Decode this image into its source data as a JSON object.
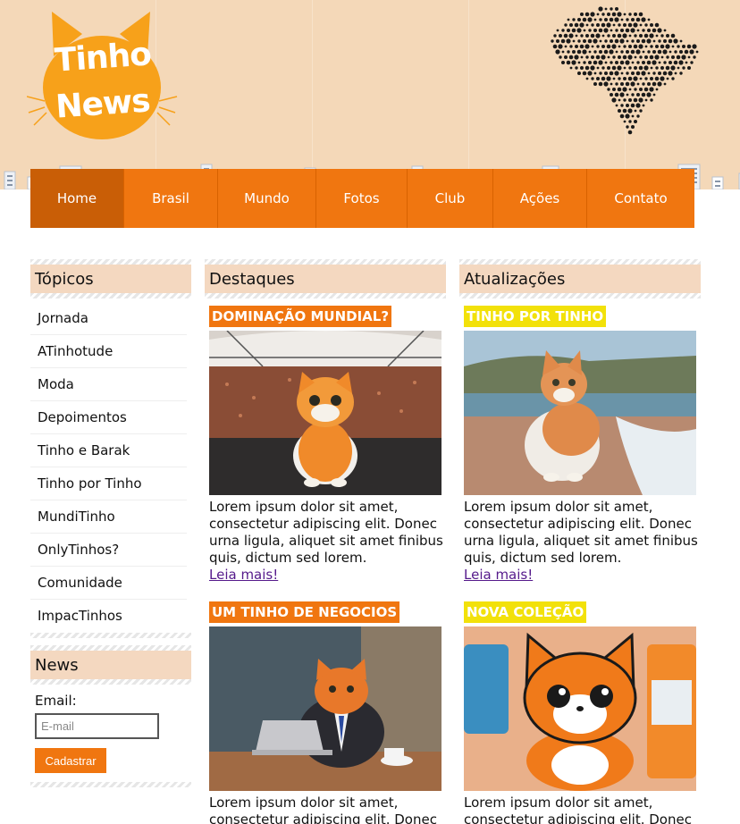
{
  "brand": {
    "line1": "Tinho",
    "line2": "News"
  },
  "nav": {
    "items": [
      {
        "label": "Home"
      },
      {
        "label": "Brasil"
      },
      {
        "label": "Mundo"
      },
      {
        "label": "Fotos"
      },
      {
        "label": "Club"
      },
      {
        "label": "Ações"
      },
      {
        "label": "Contato"
      }
    ],
    "active": "Home"
  },
  "sidebar": {
    "topics_title": "Tópicos",
    "topics": [
      "Jornada",
      "ATinhotude",
      "Moda",
      "Depoimentos",
      "Tinho e Barak",
      "Tinho por Tinho",
      "MundiTinho",
      "OnlyTinhos?",
      "Comunidade",
      "ImpacTinhos"
    ],
    "news_title": "News",
    "email_label": "Email:",
    "email_placeholder": "E-mail",
    "submit_label": "Cadastrar"
  },
  "columns": {
    "destaques": {
      "title": "Destaques",
      "articles": [
        {
          "tag": "DOMINAÇÃO MUNDIAL?",
          "text": "Lorem ipsum dolor sit amet, consectetur adipiscing elit. Donec urna ligula, aliquet sit amet finibus quis, dictum sed lorem.",
          "more": "Leia mais!"
        },
        {
          "tag": "UM TINHO DE NEGOCIOS",
          "text": "Lorem ipsum dolor sit amet, consectetur adipiscing elit. Donec urna ligula, aliquet sit amet finibus quis, dictum sed lorem."
        }
      ]
    },
    "atualizacoes": {
      "title": "Atualizações",
      "articles": [
        {
          "tag": "TINHO POR TINHO",
          "text": "Lorem ipsum dolor sit amet, consectetur adipiscing elit. Donec urna ligula, aliquet sit amet finibus quis, dictum sed lorem.",
          "more": "Leia mais!"
        },
        {
          "tag": "NOVA COLEÇÃO",
          "text": "Lorem ipsum dolor sit amet, consectetur adipiscing elit. Donec urna ligula, aliquet sit amet finibus quis, dictum sed lorem."
        }
      ]
    }
  },
  "colors": {
    "accent": "#f07610",
    "accent_dark": "#c95e06",
    "highlight": "#f2e10a",
    "header_bg": "#f4d8b8",
    "box_title_bg": "#f4d8c0",
    "link_visited": "#551a8b"
  }
}
